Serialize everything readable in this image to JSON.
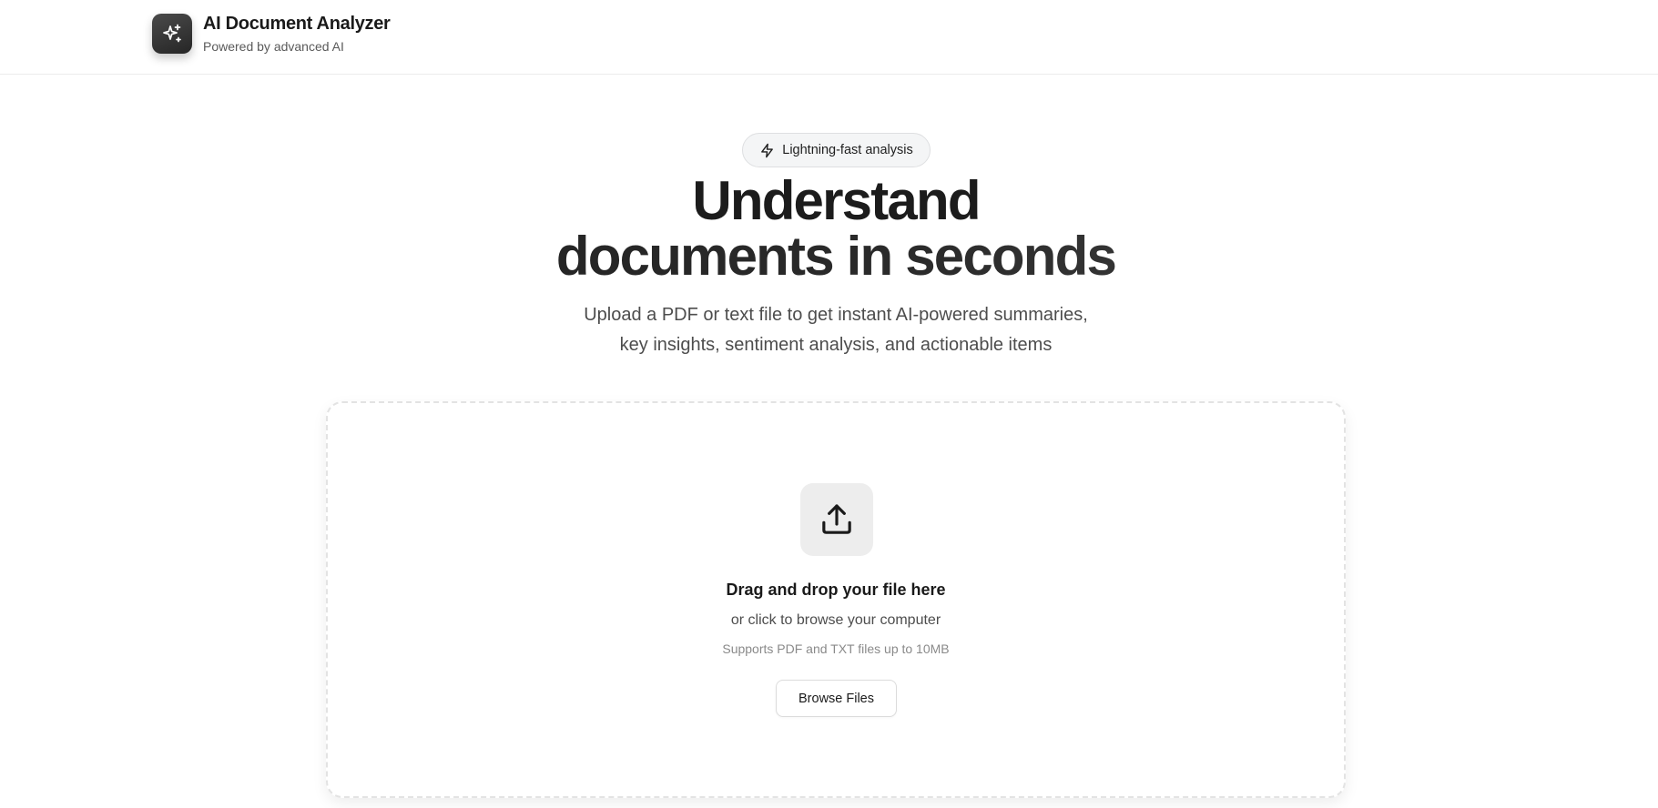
{
  "header": {
    "title": "AI Document Analyzer",
    "subtitle": "Powered by advanced AI",
    "logo_icon": "sparkles-icon"
  },
  "hero": {
    "badge": {
      "label": "Lightning-fast analysis",
      "icon": "lightning-icon"
    },
    "title_line1": "Understand",
    "title_line2": "documents in seconds",
    "description_line1": "Upload a PDF or text file to get instant AI-powered summaries,",
    "description_line2": "key insights, sentiment analysis, and actionable items"
  },
  "dropzone": {
    "icon": "upload-icon",
    "title": "Drag and drop your file here",
    "subtitle": "or click to browse your computer",
    "note": "Supports PDF and TXT files up to 10MB",
    "button_label": "Browse Files"
  },
  "colors": {
    "logo_background": "#2e2e2e",
    "badge_background": "#f4f5f6",
    "upload_icon_background": "#ededed",
    "text_primary": "#1c1c1c",
    "text_secondary": "#4d4d4d",
    "text_muted": "#8a8a8a"
  }
}
